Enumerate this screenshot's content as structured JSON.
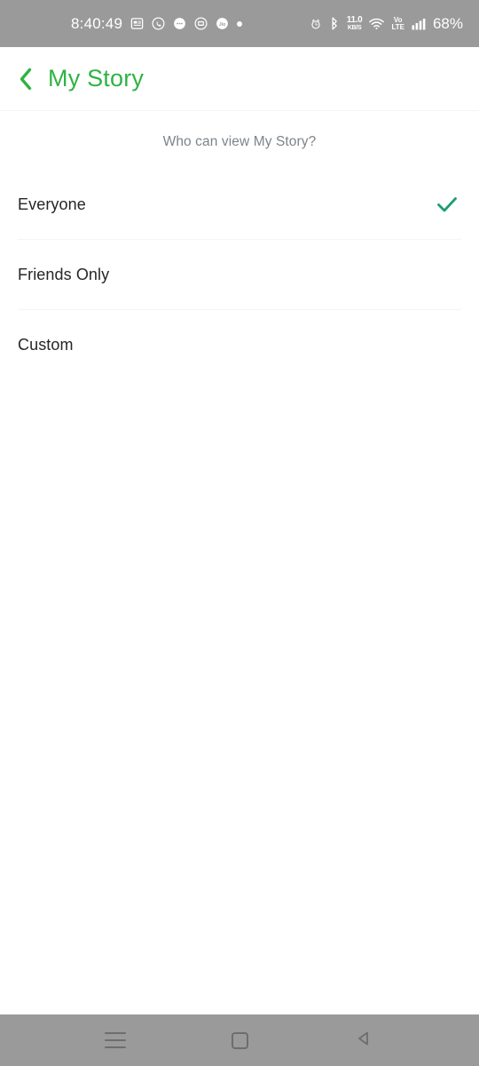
{
  "status_bar": {
    "time": "8:40:49",
    "battery": "68%",
    "data_rate_value": "11.0",
    "data_rate_unit": "KB/S",
    "volte_top": "Vo",
    "volte_bottom": "LTE",
    "left_icons": [
      "news-document-icon",
      "whatsapp-icon",
      "message-bubble-icon",
      "app-rounded-icon",
      "jio-icon",
      "notification-dot-icon"
    ],
    "right_icons": [
      "alarm-clock-icon",
      "bluetooth-icon",
      "data-rate-indicator",
      "wifi-icon",
      "volte-icon",
      "signal-bars-icon"
    ],
    "background_color": "#9a9a9a"
  },
  "header": {
    "back_label": "back",
    "title": "My Story",
    "accent_color": "#2fb344"
  },
  "main": {
    "section_caption": "Who can view My Story?",
    "options": [
      {
        "label": "Everyone",
        "selected": true
      },
      {
        "label": "Friends Only",
        "selected": false
      },
      {
        "label": "Custom",
        "selected": false
      }
    ],
    "check_color": "#1a9e70"
  },
  "nav_bar": {
    "buttons": [
      "recents-button",
      "home-button",
      "back-button"
    ],
    "background_color": "#9a9a9a"
  }
}
